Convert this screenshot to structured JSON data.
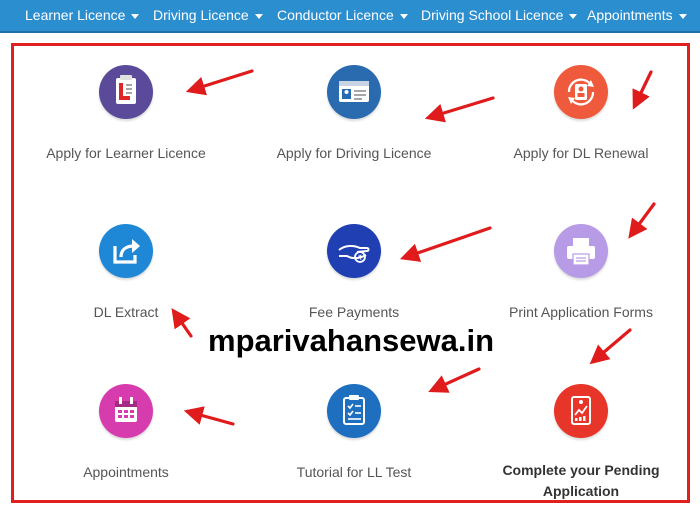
{
  "nav": {
    "items": [
      "Learner Licence",
      "Driving Licence",
      "Conductor Licence",
      "Driving School Licence",
      "Appointments"
    ]
  },
  "tiles": [
    {
      "label": "Apply for Learner Licence",
      "icon": "learner-licence-icon",
      "color": "#5b4a9a"
    },
    {
      "label": "Apply for Driving Licence",
      "icon": "driving-licence-card-icon",
      "color": "#2a6bb0"
    },
    {
      "label": "Apply for DL Renewal",
      "icon": "dl-renewal-icon",
      "color": "#f05a3c"
    },
    {
      "label": "DL Extract",
      "icon": "share-extract-icon",
      "color": "#1e88d6"
    },
    {
      "label": "Fee Payments",
      "icon": "fee-payment-hand-icon",
      "color": "#1f3fb3"
    },
    {
      "label": "Print Application Forms",
      "icon": "printer-icon",
      "color": "#b89be6"
    },
    {
      "label": "Appointments",
      "icon": "calendar-icon",
      "color": "#d63cae"
    },
    {
      "label": "Tutorial for LL Test",
      "icon": "checklist-icon",
      "color": "#1e6fc0"
    },
    {
      "label": "Complete your Pending",
      "label2": "Application",
      "icon": "pending-report-icon",
      "color": "#e8352a"
    }
  ],
  "watermark": "mparivahansewa.in",
  "colors": {
    "nav_bg": "#2a8ecf",
    "frame_border": "#e02020",
    "arrow": "#e01b1b"
  }
}
